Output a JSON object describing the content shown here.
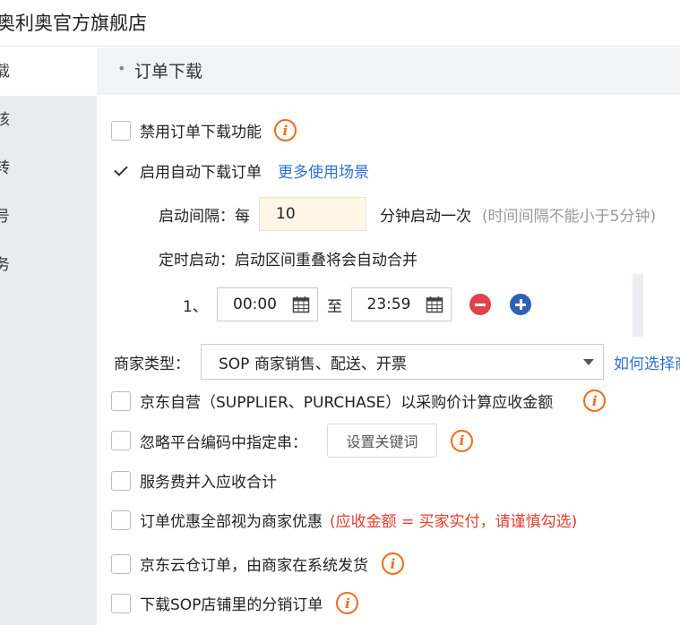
{
  "header": {
    "shop_name": "奥利奥官方旗舰店"
  },
  "sidebar": {
    "items": [
      {
        "label": "载",
        "active": true
      },
      {
        "label": "核",
        "active": false
      },
      {
        "label": "转",
        "active": false
      },
      {
        "label": "号",
        "active": false
      },
      {
        "label": "务",
        "active": false
      }
    ]
  },
  "section": {
    "title": "订单下载"
  },
  "options": {
    "disable_download": {
      "label": "禁用订单下载功能",
      "checked": false
    },
    "auto_download": {
      "label": "启用自动下载订单",
      "checked": true,
      "link": "更多使用场景"
    }
  },
  "interval": {
    "label": "启动间隔：每",
    "value": "10",
    "unit": "分钟启动一次",
    "hint": "(时间间隔不能小于5分钟)"
  },
  "timed": {
    "label": "定时启动：启动区间重叠将会自动合并",
    "ranges": [
      {
        "index": "1、",
        "start": "00:00",
        "sep": "至",
        "end": "23:59"
      }
    ]
  },
  "merchant": {
    "label": "商家类型：",
    "selected": "SOP 商家销售、配送、开票",
    "link": "如何选择商"
  },
  "checks": {
    "jd_self": {
      "label": "京东自营（SUPPLIER、PURCHASE）以采购价计算应收金额",
      "checked": false
    },
    "ignore_code": {
      "label": "忽略平台编码中指定串：",
      "checked": false,
      "button": "设置关键词"
    },
    "service_fee": {
      "label": "服务费并入应收合计",
      "checked": false
    },
    "discount": {
      "label": "订单优惠全部视为商家优惠",
      "checked": false,
      "warning": "(应收金额 = 买家实付，请谨慎勾选)"
    },
    "cloud_warehouse": {
      "label": "京东云仓订单，由商家在系统发货",
      "checked": false
    },
    "distribution": {
      "label": "下载SOP店铺里的分销订单",
      "checked": false
    }
  },
  "icons": {
    "info": "info-icon",
    "calendar": "calendar-icon",
    "remove": "minus-circle-icon",
    "add": "plus-circle-icon"
  },
  "colors": {
    "accent": "#2f6fd1",
    "info": "#ef6c1a",
    "warning": "#e23c2f",
    "remove": "#e0424b",
    "add": "#2e61b8",
    "input_bg": "#fff6e6"
  }
}
